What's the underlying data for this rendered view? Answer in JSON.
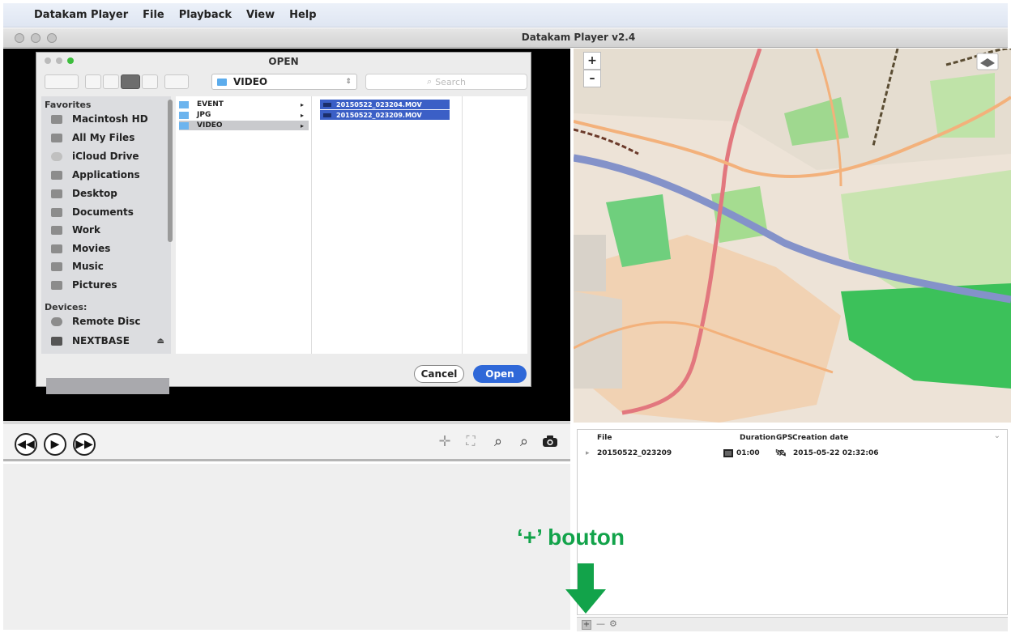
{
  "menubar": {
    "items": [
      "Datakam Player",
      "File",
      "Playback",
      "View",
      "Help"
    ]
  },
  "window": {
    "title": "Datakam Player v2.4"
  },
  "dialog": {
    "title": "OPEN",
    "folder": "VIDEO",
    "search_placeholder": "Search",
    "sidebar": {
      "favorites_heading": "Favorites",
      "favorites": [
        "Macintosh HD",
        "All My Files",
        "iCloud Drive",
        "Applications",
        "Desktop",
        "Documents",
        "Work",
        "Movies",
        "Music",
        "Pictures"
      ],
      "devices_heading": "Devices:",
      "devices": [
        "Remote Disc",
        "NEXTBASE"
      ]
    },
    "folders": [
      "EVENT",
      "JPG",
      "VIDEO"
    ],
    "files": [
      "20150522_023204.MOV",
      "20150522_023209.MOV"
    ],
    "cancel_label": "Cancel",
    "open_label": "Open"
  },
  "map": {
    "zoom_in": "+",
    "zoom_out": "–"
  },
  "file_list": {
    "headers": {
      "file": "File",
      "duration": "Duration",
      "gps": "GPS",
      "creation": "Creation date"
    },
    "rows": [
      {
        "file": "20150522_023209",
        "duration": "01:00",
        "creation": "2015-05-22 02:32:06"
      }
    ]
  },
  "annotation": {
    "label": "‘+’ bouton"
  },
  "colors": {
    "annotation": "#12a34a",
    "selection": "#3b5fc6",
    "open_button": "#2f68d8"
  },
  "icons": [
    "rewind-icon",
    "play-icon",
    "fast-forward-icon",
    "crosshair-icon",
    "fullscreen-icon",
    "zoom-in-icon",
    "zoom-out-icon",
    "camera-icon",
    "folder-icon",
    "film-icon",
    "satellite-icon",
    "gear-icon",
    "down-arrow-icon"
  ]
}
